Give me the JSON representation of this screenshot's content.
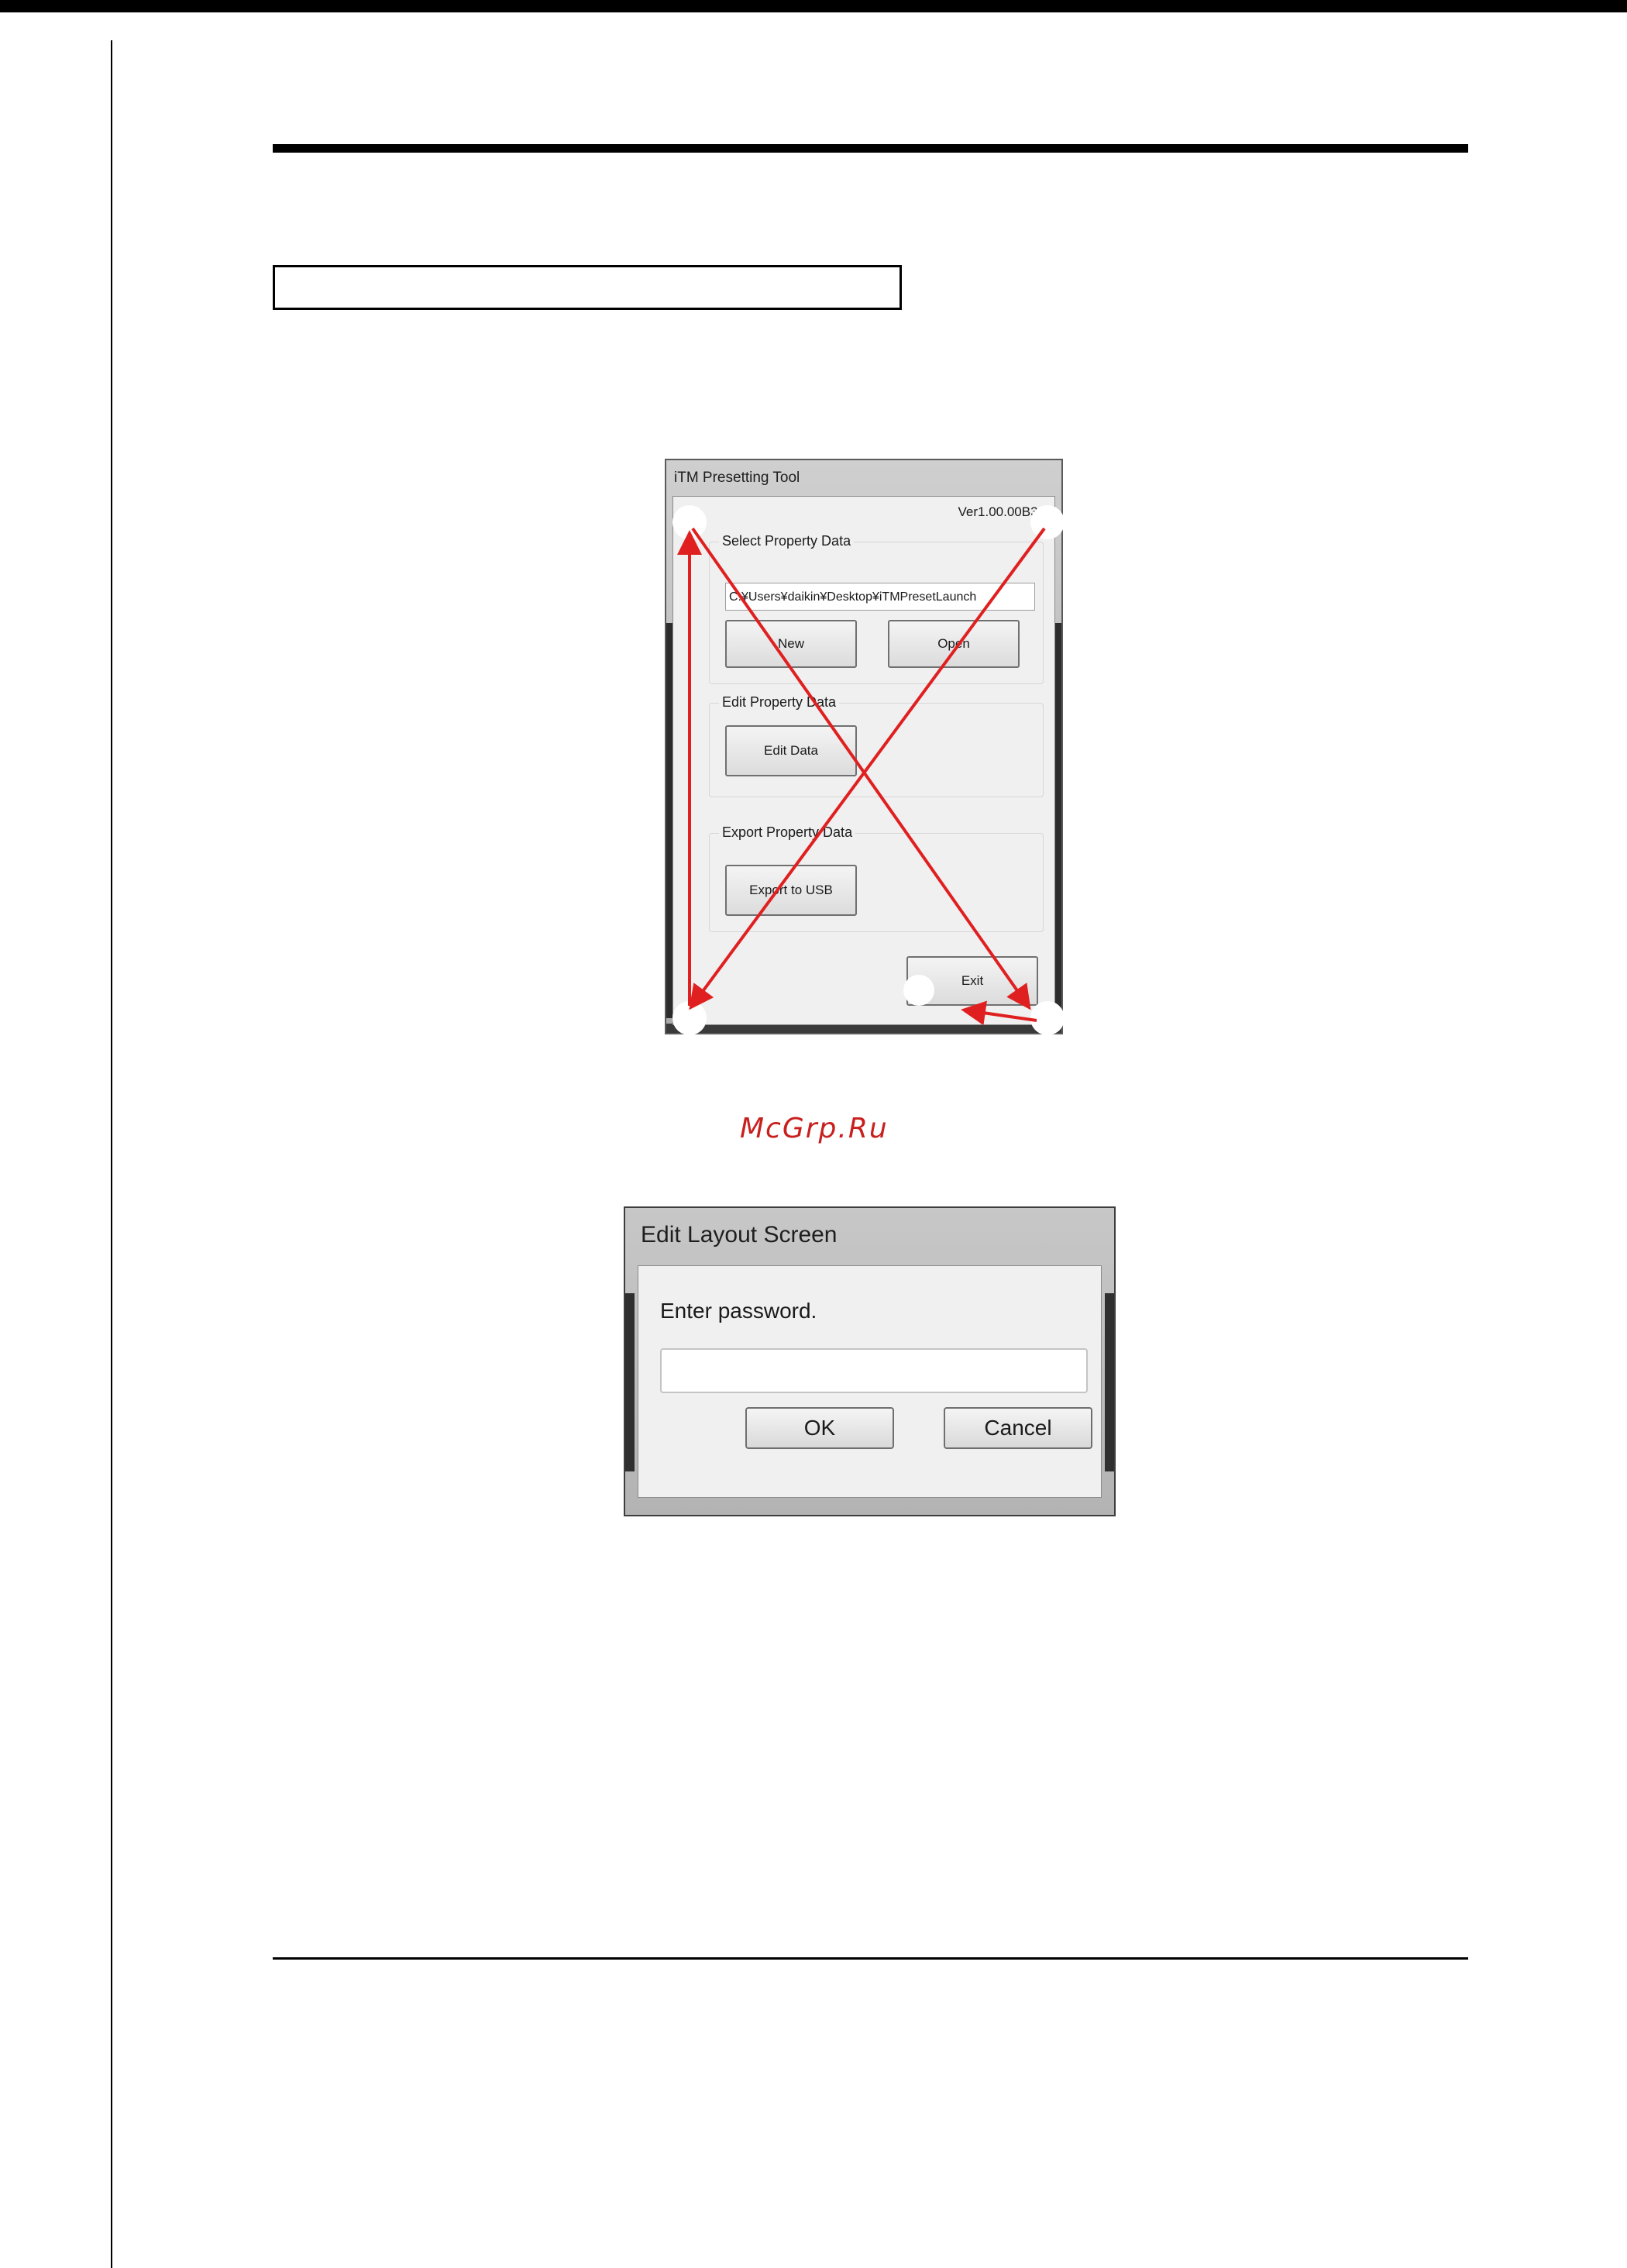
{
  "page": {
    "watermark": "McGrp.Ru"
  },
  "presetting_window": {
    "title": "iTM Presetting Tool",
    "version": "Ver1.00.00B36",
    "select_group_label": "Select Property Data",
    "path_value": "C:¥Users¥daikin¥Desktop¥iTMPresetLaunch",
    "new_label": "New",
    "open_label": "Open",
    "edit_group_label": "Edit Property Data",
    "edit_data_label": "Edit Data",
    "export_group_label": "Export Property Data",
    "export_label": "Export to USB",
    "exit_label": "Exit",
    "arrow_color": "#e02020"
  },
  "password_dialog": {
    "title": "Edit Layout Screen",
    "prompt": "Enter password.",
    "password_value": "",
    "ok_label": "OK",
    "cancel_label": "Cancel"
  }
}
